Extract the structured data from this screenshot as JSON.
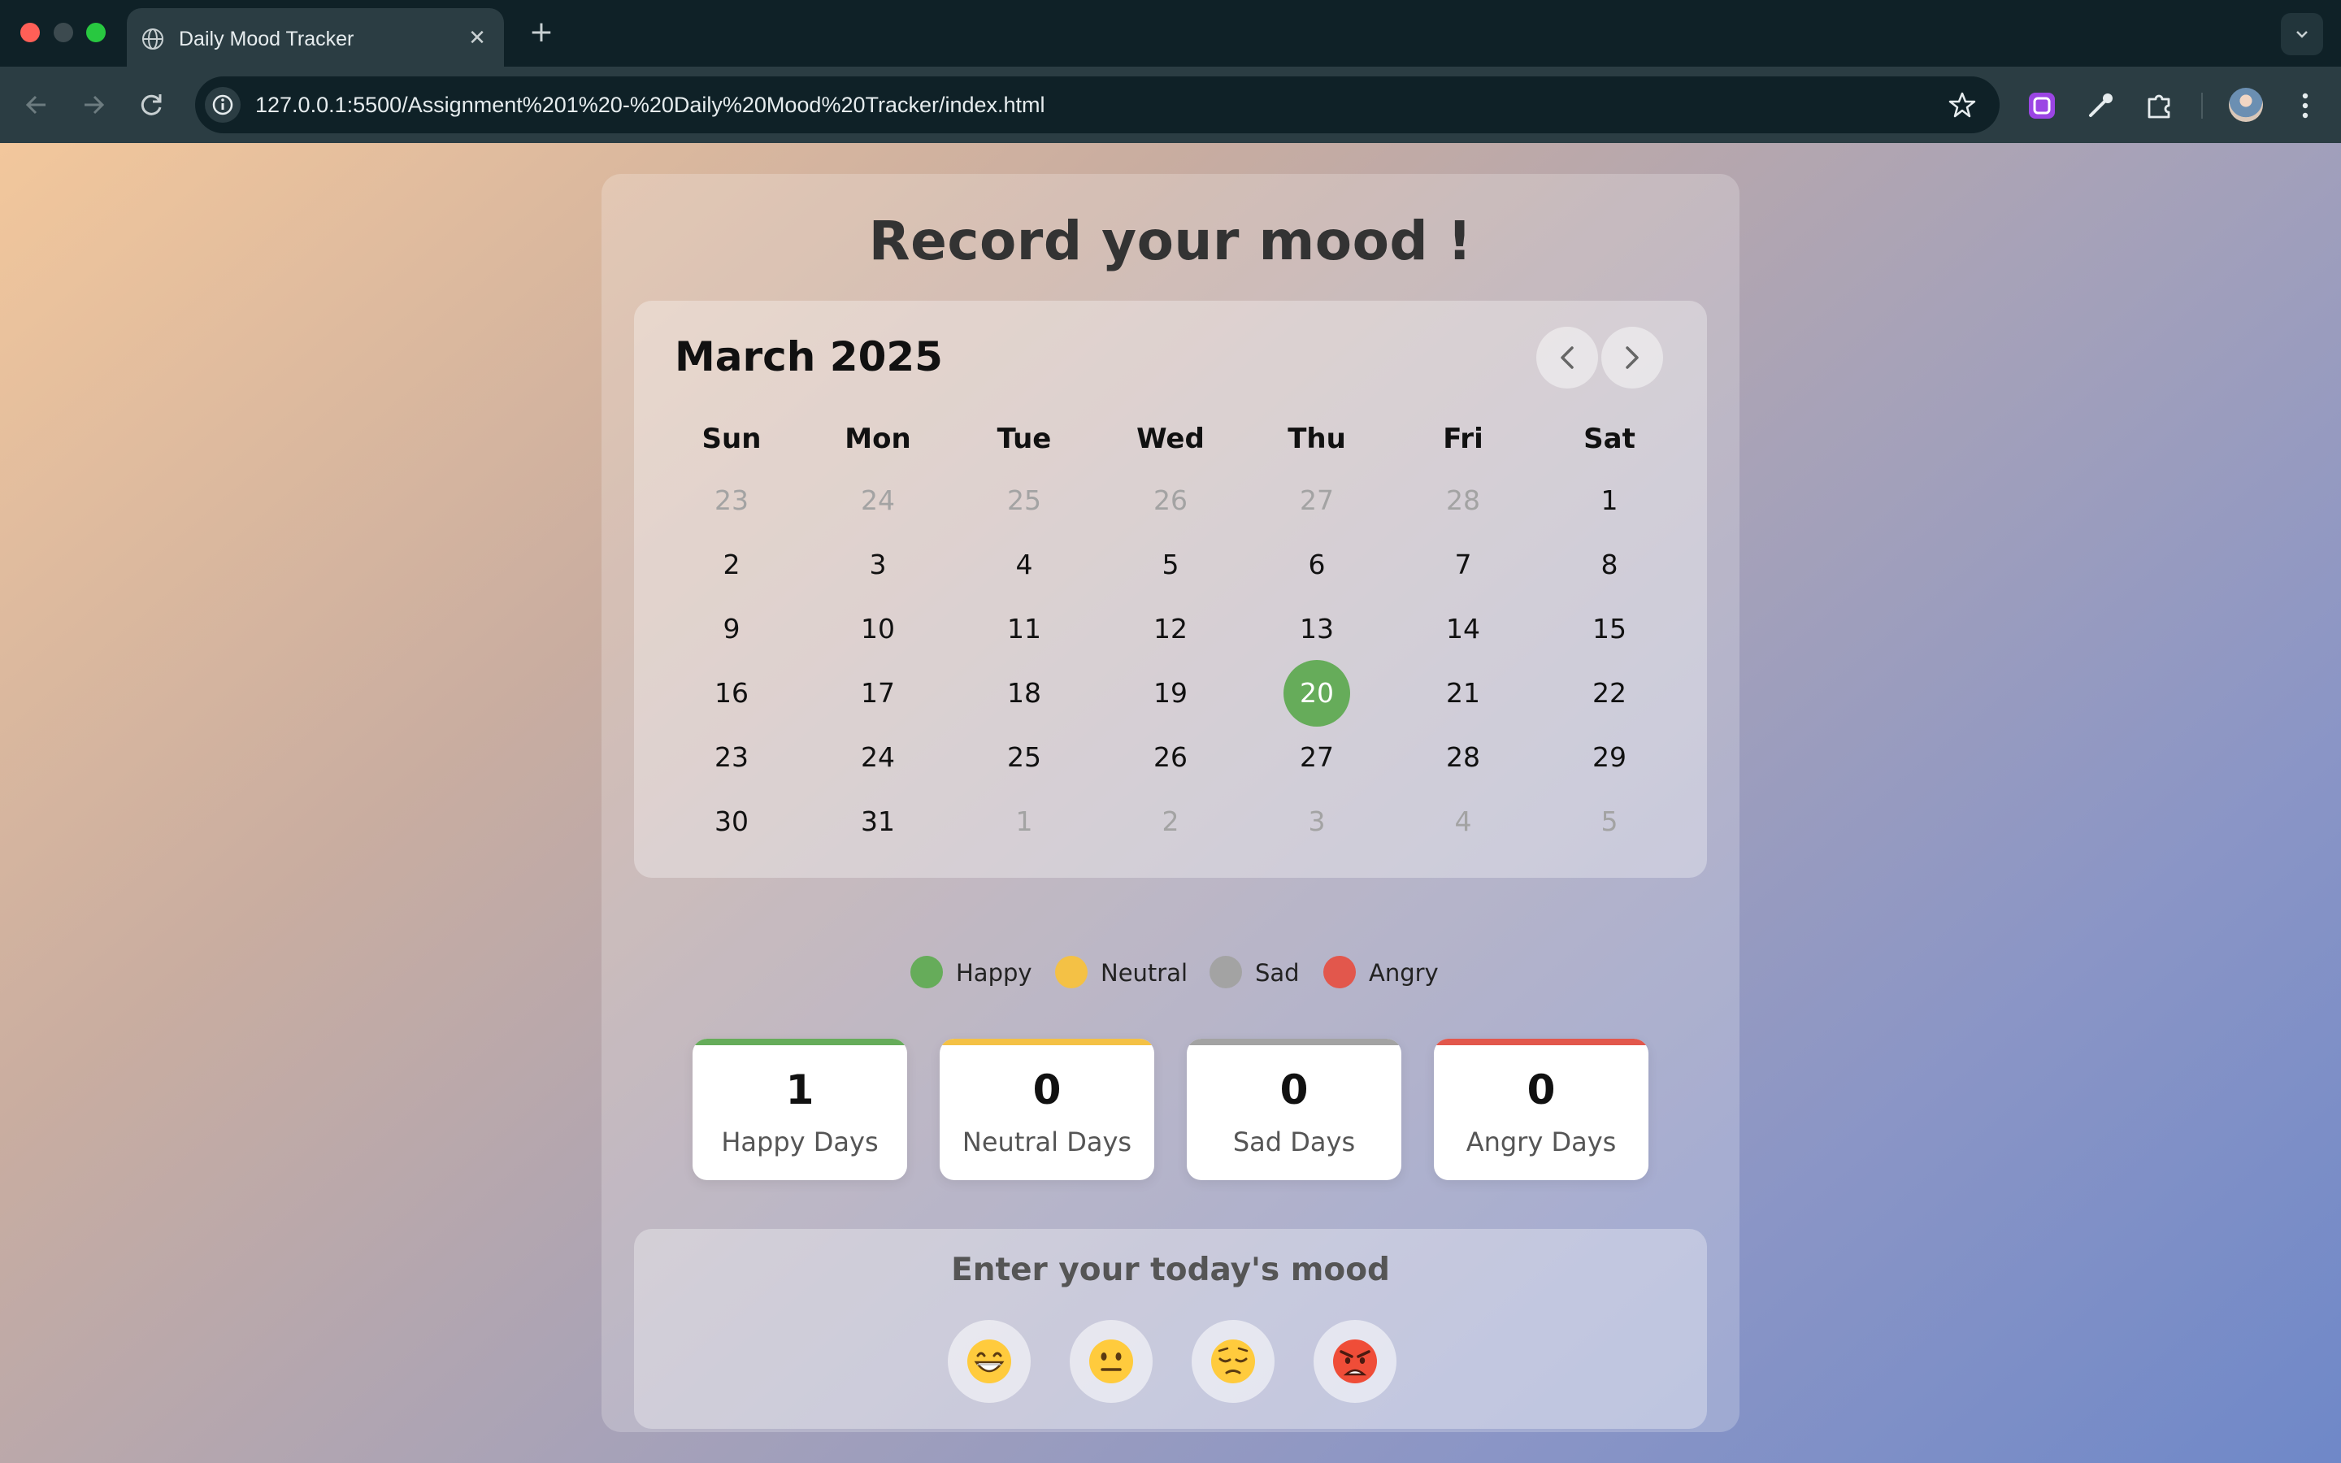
{
  "browser": {
    "tab_title": "Daily Mood Tracker",
    "tab_close": "✕",
    "new_tab": "+",
    "url": "127.0.0.1:5500/Assignment%201%20-%20Daily%20Mood%20Tracker/index.html"
  },
  "page": {
    "title": "Record your mood !"
  },
  "calendar": {
    "month_label": "March 2025",
    "weekdays": [
      "Sun",
      "Mon",
      "Tue",
      "Wed",
      "Thu",
      "Fri",
      "Sat"
    ],
    "weeks": [
      [
        "23",
        "24",
        "25",
        "26",
        "27",
        "28",
        "1"
      ],
      [
        "2",
        "3",
        "4",
        "5",
        "6",
        "7",
        "8"
      ],
      [
        "9",
        "10",
        "11",
        "12",
        "13",
        "14",
        "15"
      ],
      [
        "16",
        "17",
        "18",
        "19",
        "20",
        "21",
        "22"
      ],
      [
        "23",
        "24",
        "25",
        "26",
        "27",
        "28",
        "29"
      ],
      [
        "30",
        "31",
        "1",
        "2",
        "3",
        "4",
        "5"
      ]
    ],
    "today": "20"
  },
  "legend": [
    {
      "label": "Happy",
      "color": "#66ac5a"
    },
    {
      "label": "Neutral",
      "color": "#f4c145"
    },
    {
      "label": "Sad",
      "color": "#a3a3a3"
    },
    {
      "label": "Angry",
      "color": "#e2574c"
    }
  ],
  "stats": [
    {
      "count": "1",
      "label": "Happy Days",
      "color": "#66ac5a"
    },
    {
      "count": "0",
      "label": "Neutral Days",
      "color": "#f4c145"
    },
    {
      "count": "0",
      "label": "Sad Days",
      "color": "#a3a3a3"
    },
    {
      "count": "0",
      "label": "Angry Days",
      "color": "#e2574c"
    }
  ],
  "mood_input": {
    "title": "Enter your today's mood",
    "buttons": [
      {
        "icon": "grinning-face-icon"
      },
      {
        "icon": "neutral-face-icon"
      },
      {
        "icon": "pensive-face-icon"
      },
      {
        "icon": "angry-face-icon"
      }
    ]
  }
}
